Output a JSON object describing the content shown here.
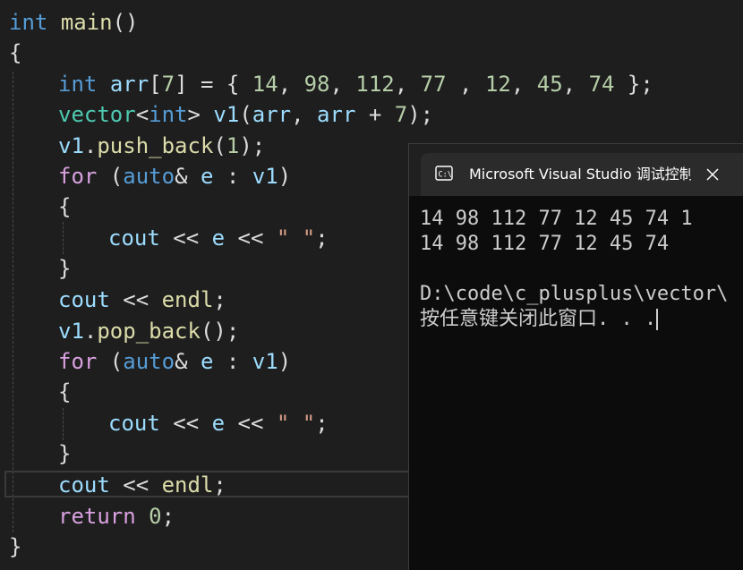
{
  "editor": {
    "lines": [
      "int main()",
      "{",
      "",
      "int arr[7] = { 14, 98, 112, 77 , 12, 45, 74 };",
      "vector<int> v1(arr, arr + 7);",
      "v1.push_back(1);",
      "for (auto& e : v1)",
      "{",
      "cout << e << \" \";",
      "}",
      "cout << endl;",
      "v1.pop_back();",
      "for (auto& e : v1)",
      "{",
      "cout << e << \" \";",
      "}",
      "cout << endl;",
      "return 0;",
      "}"
    ]
  },
  "console": {
    "title": "Microsoft Visual Studio 调试控制台",
    "icon": "console-app-icon",
    "close_icon": "close-icon",
    "output": [
      "14 98 112 77 12 45 74 1",
      "14 98 112 77 12 45 74",
      "",
      "D:\\code\\c_plusplus\\vector\\",
      "按任意键关闭此窗口. . ."
    ]
  },
  "colors": {
    "editor_bg": "#1e1e1e",
    "keyword": "#569cd6",
    "control_keyword": "#d8a0df",
    "function": "#dcdcaa",
    "type": "#4ec9b0",
    "variable": "#9cdcfe",
    "number": "#b5cea8",
    "string": "#d69d85",
    "console_bg": "#0c0c0c",
    "console_text": "#cccccc"
  }
}
